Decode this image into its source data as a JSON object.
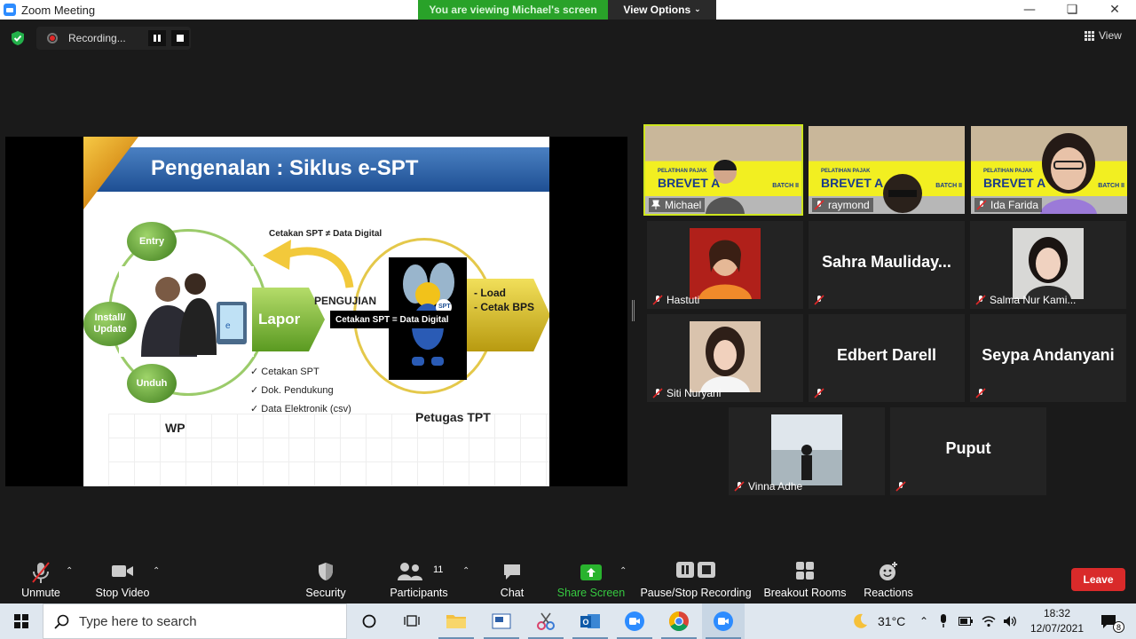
{
  "window": {
    "title": "Zoom Meeting"
  },
  "banner": {
    "viewing": "You are viewing Michael's screen",
    "view_options": "View Options"
  },
  "recording": {
    "label": "Recording..."
  },
  "view_button": {
    "label": "View"
  },
  "slide": {
    "title": "Pengenalan : Siklus e-SPT",
    "entry": "Entry",
    "install": "Install/ Update",
    "unduh": "Unduh",
    "lapor": "Lapor",
    "pengujian": "PENGUJIAN",
    "cetakan_not": "Cetakan  SPT ≠ Data Digital",
    "cetakan_eq": "Cetakan  SPT = Data Digital",
    "load": "- Load",
    "cetak_bps": "- Cetak BPS",
    "checklist": [
      "Cetakan  SPT",
      "Dok. Pendukung",
      "Data Elektronik (csv)"
    ],
    "wp": "WP",
    "petugas": "Petugas TPT",
    "logo": "SPT"
  },
  "banner_tile": {
    "pelatihan": "PELATIHAN PAJAK",
    "brevet": "BREVET A",
    "batch": "BATCH II"
  },
  "participants": [
    {
      "name": "Michael",
      "video": true,
      "active": true
    },
    {
      "name": "raymond",
      "video": true
    },
    {
      "name": "Ida Farida",
      "video": true
    },
    {
      "name": "Hastuti",
      "photo": true
    },
    {
      "name": "Sahra  Mauliday...",
      "display": "Sahra  Mauliday..."
    },
    {
      "name": "Salma Nur Kami...",
      "photo": true
    },
    {
      "name": "Siti Nuryani",
      "photo": true
    },
    {
      "name": "Edbert Darell",
      "display": "Edbert Darell"
    },
    {
      "name": "Seypa Andanyani",
      "display": "Seypa Andanyani"
    },
    {
      "name": "Vinna Adhe",
      "photo": true
    },
    {
      "name": "Puput",
      "display": "Puput"
    }
  ],
  "toolbar": {
    "unmute": "Unmute",
    "stop_video": "Stop Video",
    "security": "Security",
    "participants": "Participants",
    "participants_count": "11",
    "chat": "Chat",
    "share_screen": "Share Screen",
    "pause_stop": "Pause/Stop Recording",
    "breakout": "Breakout Rooms",
    "reactions": "Reactions",
    "leave": "Leave"
  },
  "taskbar": {
    "search_placeholder": "Type here to search",
    "temperature": "31°C",
    "time": "18:32",
    "date": "12/07/2021",
    "notification_count": "8"
  },
  "colors": {
    "active_speaker": "#cee61e",
    "share_green": "#29a229",
    "leave_red": "#d92a2a"
  }
}
